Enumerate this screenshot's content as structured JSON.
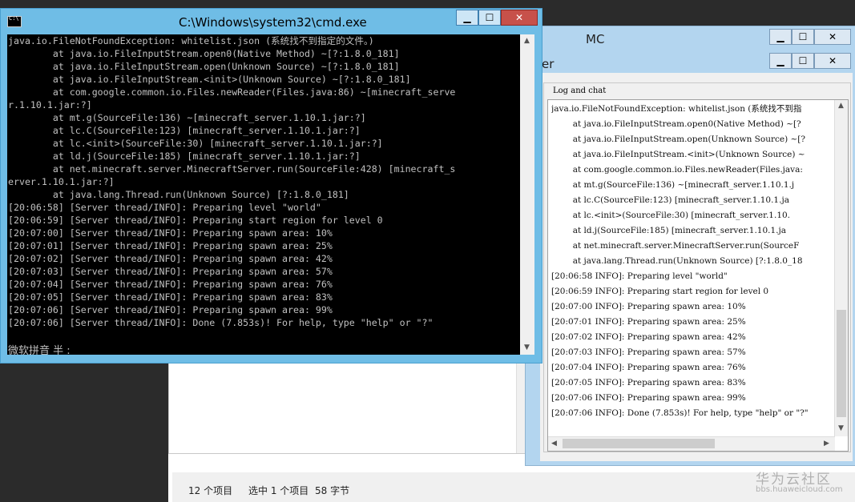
{
  "cmd": {
    "title": "C:\\Windows\\system32\\cmd.exe",
    "icon_label": "C:\\",
    "lines": [
      "java.io.FileNotFoundException: whitelist.json (系统找不到指定的文件。)",
      "        at java.io.FileInputStream.open0(Native Method) ~[?:1.8.0_181]",
      "        at java.io.FileInputStream.open(Unknown Source) ~[?:1.8.0_181]",
      "        at java.io.FileInputStream.<init>(Unknown Source) ~[?:1.8.0_181]",
      "        at com.google.common.io.Files.newReader(Files.java:86) ~[minecraft_serve",
      "r.1.10.1.jar:?]",
      "        at mt.g(SourceFile:136) ~[minecraft_server.1.10.1.jar:?]",
      "        at lc.C(SourceFile:123) [minecraft_server.1.10.1.jar:?]",
      "        at lc.<init>(SourceFile:30) [minecraft_server.1.10.1.jar:?]",
      "        at ld.j(SourceFile:185) [minecraft_server.1.10.1.jar:?]",
      "        at net.minecraft.server.MinecraftServer.run(SourceFile:428) [minecraft_s",
      "erver.1.10.1.jar:?]",
      "        at java.lang.Thread.run(Unknown Source) [?:1.8.0_181]",
      "[20:06:58] [Server thread/INFO]: Preparing level \"world\"",
      "[20:06:59] [Server thread/INFO]: Preparing start region for level 0",
      "[20:07:00] [Server thread/INFO]: Preparing spawn area: 10%",
      "[20:07:01] [Server thread/INFO]: Preparing spawn area: 25%",
      "[20:07:02] [Server thread/INFO]: Preparing spawn area: 42%",
      "[20:07:03] [Server thread/INFO]: Preparing spawn area: 57%",
      "[20:07:04] [Server thread/INFO]: Preparing spawn area: 76%",
      "[20:07:05] [Server thread/INFO]: Preparing spawn area: 83%",
      "[20:07:06] [Server thread/INFO]: Preparing spawn area: 99%",
      "[20:07:06] [Server thread/INFO]: Done (7.853s)! For help, type \"help\" or \"?\""
    ],
    "ime_text": "微软拼音 半 :"
  },
  "mc": {
    "title": "MC",
    "inner_title": "er",
    "log_legend": "Log and chat",
    "log_lines": [
      "java.io.FileNotFoundException: whitelist.json (系统找不到指",
      "        at java.io.FileInputStream.open0(Native Method) ~[?",
      "        at java.io.FileInputStream.open(Unknown Source) ~[?",
      "        at java.io.FileInputStream.<init>(Unknown Source) ~",
      "        at com.google.common.io.Files.newReader(Files.java:",
      "        at mt.g(SourceFile:136) ~[minecraft_server.1.10.1.j",
      "        at lc.C(SourceFile:123) [minecraft_server.1.10.1.ja",
      "        at lc.<init>(SourceFile:30) [minecraft_server.1.10.",
      "        at ld.j(SourceFile:185) [minecraft_server.1.10.1.ja",
      "        at net.minecraft.server.MinecraftServer.run(SourceF",
      "        at java.lang.Thread.run(Unknown Source) [?:1.8.0_18",
      "[20:06:58 INFO]: Preparing level \"world\"",
      "[20:06:59 INFO]: Preparing start region for level 0",
      "[20:07:00 INFO]: Preparing spawn area: 10%",
      "[20:07:01 INFO]: Preparing spawn area: 25%",
      "[20:07:02 INFO]: Preparing spawn area: 42%",
      "[20:07:03 INFO]: Preparing spawn area: 57%",
      "[20:07:04 INFO]: Preparing spawn area: 76%",
      "[20:07:05 INFO]: Preparing spawn area: 83%",
      "[20:07:06 INFO]: Preparing spawn area: 99%",
      "[20:07:06 INFO]: Done (7.853s)! For help, type \"help\" or \"?\""
    ]
  },
  "window_buttons": {
    "minimize": "▁",
    "maximize": "☐",
    "close": "✕"
  },
  "explorer": {
    "item_count": "12 个项目",
    "selected": "选中 1 个项目",
    "size": "58 字节"
  },
  "watermark": {
    "brand": "华为云社区",
    "url": "bbs.huaweicloud.com"
  }
}
